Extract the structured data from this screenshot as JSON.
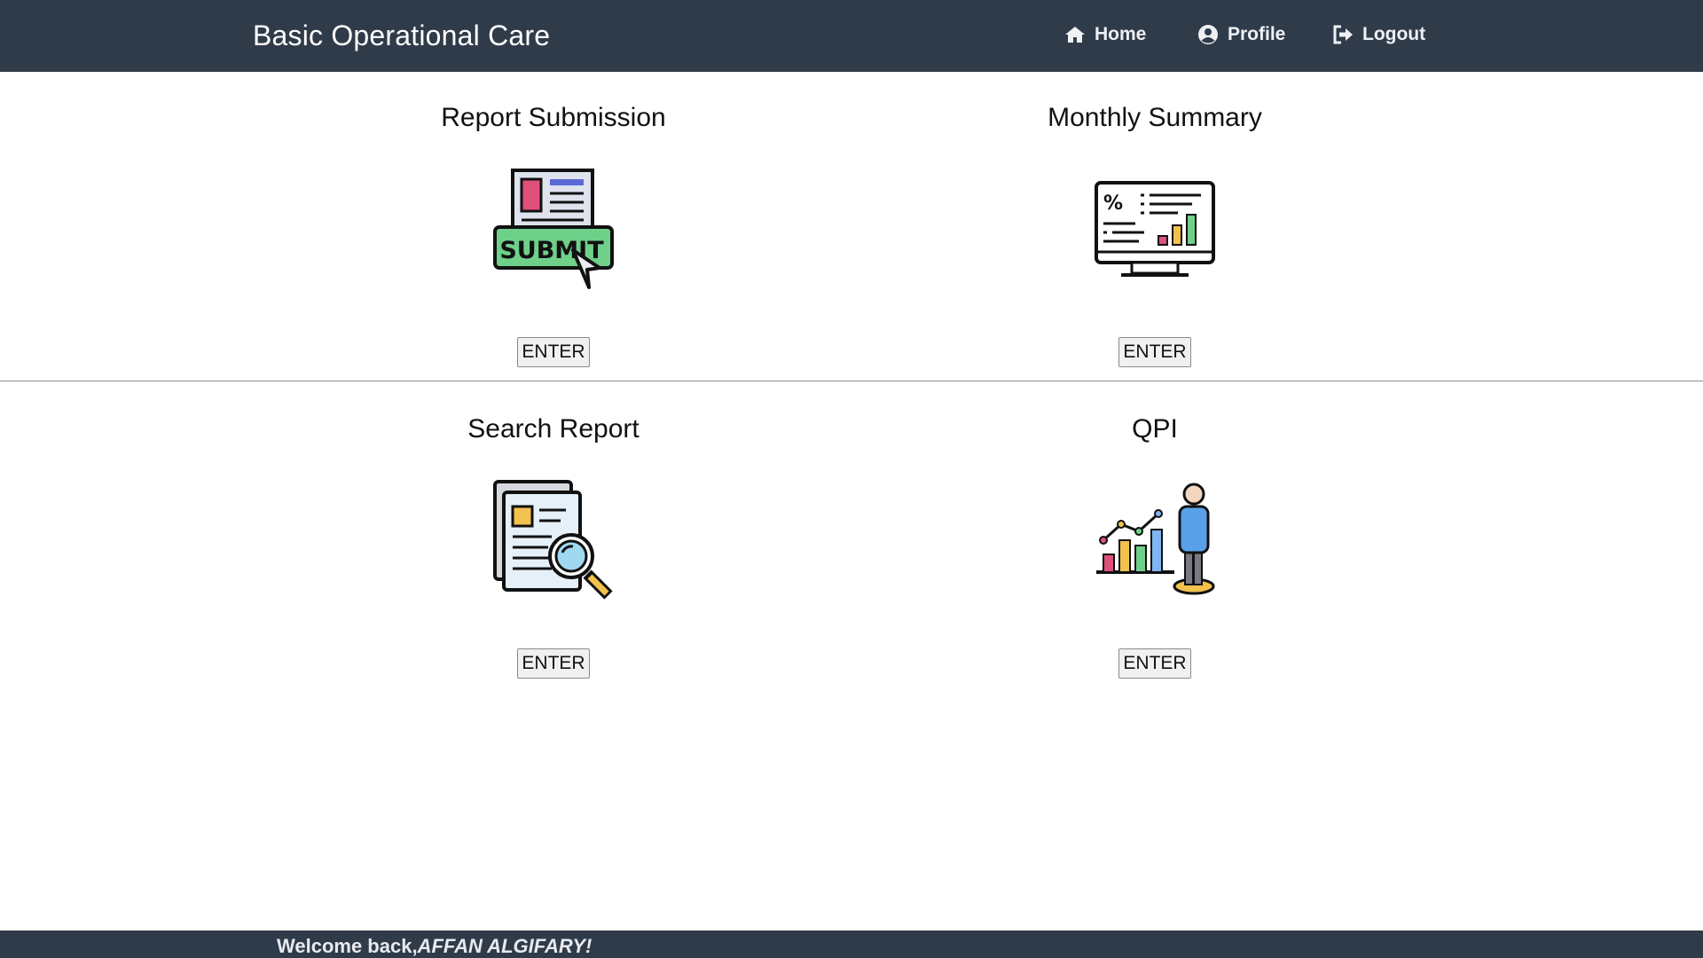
{
  "header": {
    "title": "Basic Operational Care",
    "nav": [
      {
        "label": "Home",
        "icon": "home-icon"
      },
      {
        "label": "Profile",
        "icon": "user-circle-icon"
      },
      {
        "label": "Logout",
        "icon": "logout-icon"
      }
    ],
    "background": "#303b4a"
  },
  "cards": [
    {
      "title": "Report Submission",
      "icon": "submit-form-icon",
      "button": "ENTER"
    },
    {
      "title": "Monthly Summary",
      "icon": "monitor-statistics-icon",
      "button": "ENTER"
    },
    {
      "title": "Search Report",
      "icon": "document-search-icon",
      "button": "ENTER"
    },
    {
      "title": "QPI",
      "icon": "presenter-chart-icon",
      "button": "ENTER"
    }
  ],
  "footer": {
    "greeting": "Welcome back,",
    "username": "AFFAN ALGIFARY!"
  }
}
